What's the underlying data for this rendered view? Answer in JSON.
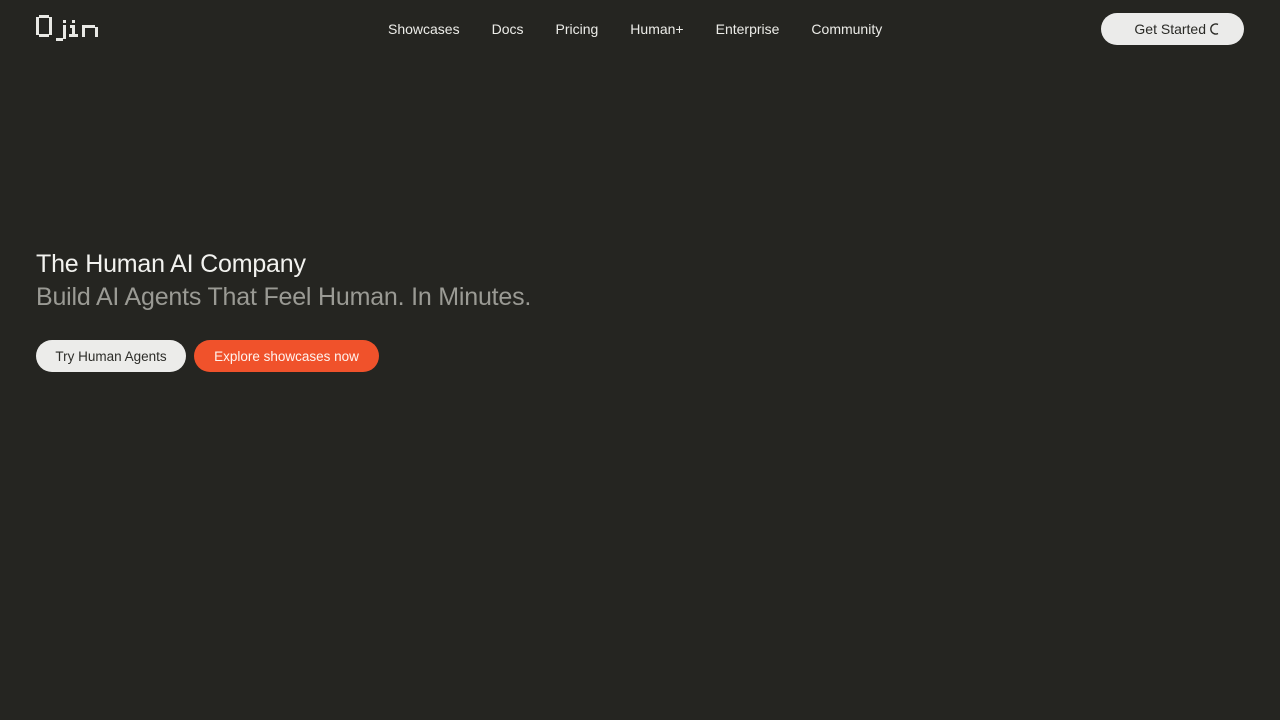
{
  "brand": {
    "logo_text": "Ojin",
    "accent_color": "#f0522b",
    "background_color": "#252521"
  },
  "nav": {
    "items": [
      {
        "label": "Showcases"
      },
      {
        "label": "Docs"
      },
      {
        "label": "Pricing"
      },
      {
        "label": "Human+"
      },
      {
        "label": "Enterprise"
      },
      {
        "label": "Community"
      }
    ]
  },
  "header": {
    "cta_label": "Get Started",
    "cta_icon": "spinner-icon"
  },
  "hero": {
    "title": "The Human AI Company",
    "subtitle": "Build AI Agents That Feel Human. In Minutes."
  },
  "cta": {
    "primary_label": "Try Human Agents",
    "secondary_label": "Explore showcases now"
  }
}
